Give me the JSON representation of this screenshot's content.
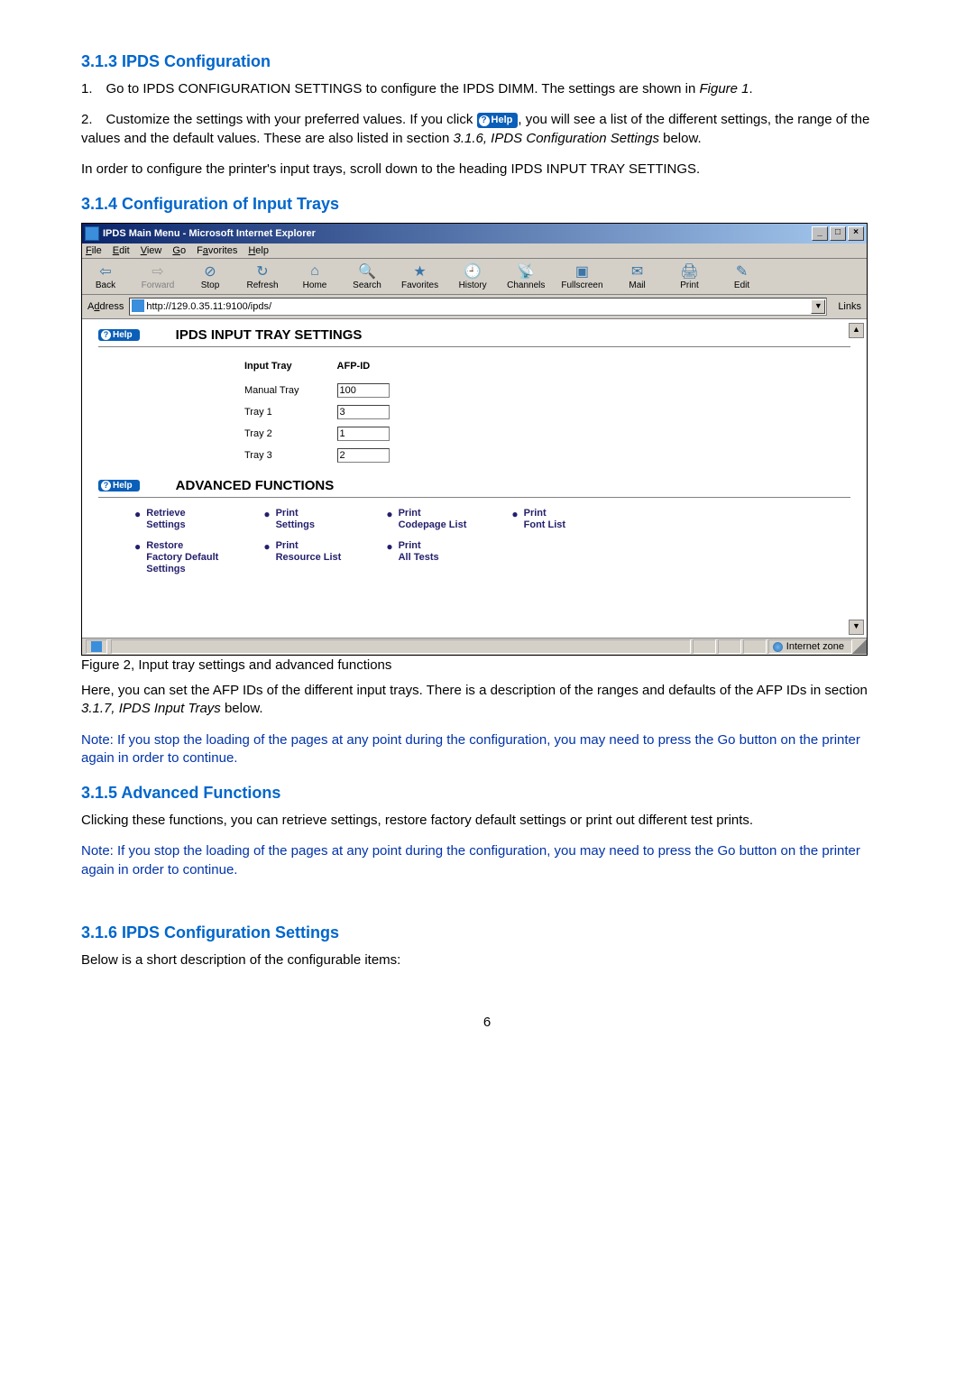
{
  "sections": {
    "s313_title": "3.1.3  IPDS Configuration",
    "s313_p1_pre": "1. Go to IPDS CONFIGURATION SETTINGS to configure the IPDS DIMM. The settings are shown in ",
    "s313_p1_ref": "Figure 1",
    "s313_p1_post": ".",
    "s313_p2_a": "2. Customize the settings with your preferred values. If you click ",
    "s313_help_label": "Help",
    "s313_p2_b": ", you will see a list of the different settings, the range of the values and the default values. These are also listed in section ",
    "s313_p2_ref": "3.1.6, IPDS Configuration Settings",
    "s313_p2_c": " below.",
    "s313_p3": "In order to configure the printer's input trays, scroll down to the heading IPDS INPUT TRAY SETTINGS.",
    "s314_title": "3.1.4  Configuration of Input Trays",
    "s315_title": "3.1.5  Advanced Functions",
    "s315_p1": "Clicking these functions, you can retrieve settings, restore factory default settings or print out different test prints.",
    "s316_title": "3.1.6  IPDS Configuration Settings",
    "s316_p1": "Below is a short description of the configurable items:",
    "fig_caption": "Figure 2, Input tray settings and advanced functions",
    "here_p": "Here, you can set the AFP IDs of the different input trays. There is a description of the ranges and defaults of the AFP IDs in section ",
    "here_ref": "3.1.7, IPDS Input Trays",
    "here_post": " below.",
    "note": "Note: If you stop the loading of the pages at any point during the configuration, you may need to press the Go button on the printer again in order to continue."
  },
  "ie": {
    "title": "IPDS Main Menu - Microsoft Internet Explorer",
    "menus": {
      "file": "File",
      "edit": "Edit",
      "view": "View",
      "go": "Go",
      "favorites": "Favorites",
      "help": "Help"
    },
    "toolbar": {
      "back": "Back",
      "forward": "Forward",
      "stop": "Stop",
      "refresh": "Refresh",
      "home": "Home",
      "search": "Search",
      "favorites": "Favorites",
      "history": "History",
      "channels": "Channels",
      "fullscreen": "Fullscreen",
      "mail": "Mail",
      "print": "Print",
      "edit": "Edit"
    },
    "address_label": "Address",
    "address_value": "http://129.0.35.11:9100/ipds/",
    "links_label": "Links",
    "sect_input_title": "IPDS INPUT TRAY SETTINGS",
    "col_input": "Input Tray",
    "col_afp": "AFP-ID",
    "trays": [
      {
        "name": "Manual Tray",
        "value": "100"
      },
      {
        "name": "Tray 1",
        "value": "3"
      },
      {
        "name": "Tray 2",
        "value": "1"
      },
      {
        "name": "Tray 3",
        "value": "2"
      }
    ],
    "sect_adv_title": "ADVANCED FUNCTIONS",
    "adv": {
      "retrieve": "Retrieve Settings",
      "restore": "Restore Factory Default Settings",
      "print_settings": "Print Settings",
      "print_resource": "Print Resource List",
      "print_codepage": "Print Codepage List",
      "print_alltests": "Print All Tests",
      "print_fontlist": "Print Font List"
    },
    "status_zone": "Internet zone",
    "help_pill": "Help"
  },
  "page_number": "6"
}
